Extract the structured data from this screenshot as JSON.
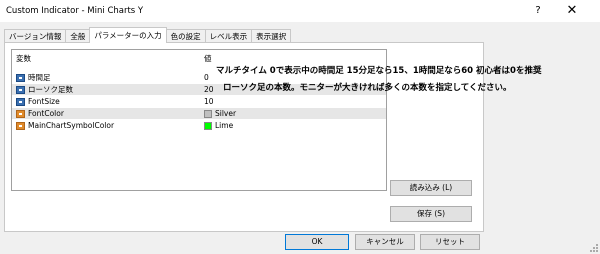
{
  "window": {
    "title": "Custom Indicator - Mini Charts Y",
    "help_label": "?",
    "close_label": "✕"
  },
  "tabs": [
    {
      "label": "バージョン情報"
    },
    {
      "label": "全般"
    },
    {
      "label": "パラメーターの入力",
      "active": true
    },
    {
      "label": "色の設定"
    },
    {
      "label": "レベル表示"
    },
    {
      "label": "表示選択"
    }
  ],
  "table": {
    "headers": {
      "variable": "変数",
      "value": "値"
    },
    "rows": [
      {
        "name": "時間足",
        "value": "0",
        "icon": "integer-param-icon"
      },
      {
        "name": "ローソク足数",
        "value": "20",
        "icon": "integer-param-icon"
      },
      {
        "name": "FontSize",
        "value": "10",
        "icon": "integer-param-icon"
      },
      {
        "name": "FontColor",
        "value": "Silver",
        "icon": "color-param-icon",
        "swatch": "#c0c0c0"
      },
      {
        "name": "MainChartSymbolColor",
        "value": "Lime",
        "icon": "color-param-icon",
        "swatch": "#00ff00"
      }
    ]
  },
  "notes": {
    "line1": "マルチタイム 0で表示中の時間足 15分足なら15、1時間足なら60 初心者は0を推奨",
    "line2": "ローソク足の本数。モニターが大きければ多くの本数を指定してください。"
  },
  "buttons": {
    "load": "読み込み (L)",
    "save": "保存 (S)",
    "ok": "OK",
    "cancel": "キャンセル",
    "reset": "リセット"
  },
  "colors": {
    "alt_row": "#e6e6e6",
    "primary_border": "#0078d7"
  }
}
